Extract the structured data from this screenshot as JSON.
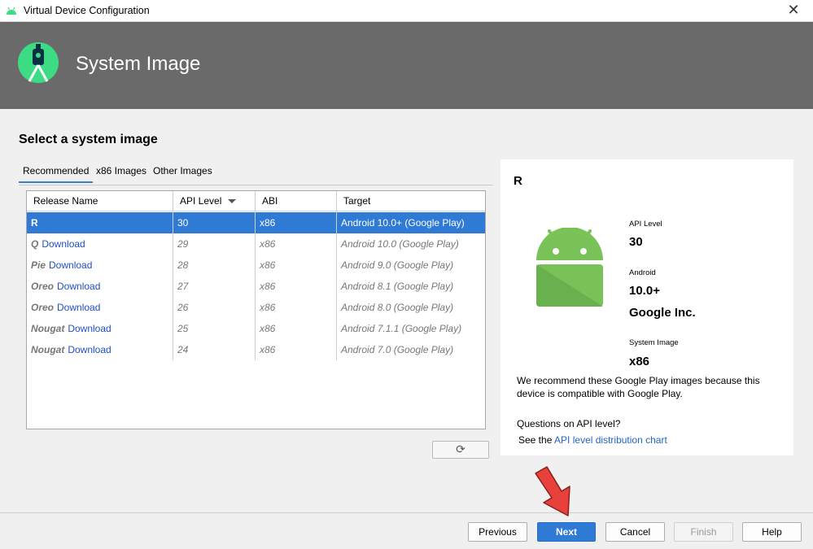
{
  "window": {
    "title": "Virtual Device Configuration",
    "close_glyph": "✕"
  },
  "header": {
    "title": "System Image"
  },
  "content": {
    "section_title": "Select a system image",
    "tabs": [
      {
        "label": "Recommended",
        "active": true
      },
      {
        "label": "x86 Images",
        "active": false
      },
      {
        "label": "Other Images",
        "active": false
      }
    ],
    "table": {
      "columns": [
        "Release Name",
        "API Level",
        "ABI",
        "Target"
      ],
      "rows": [
        {
          "release": "R",
          "download": "",
          "api": "30",
          "abi": "x86",
          "target": "Android 10.0+ (Google Play)"
        },
        {
          "release": "Q",
          "download": "Download",
          "api": "29",
          "abi": "x86",
          "target": "Android 10.0 (Google Play)"
        },
        {
          "release": "Pie",
          "download": "Download",
          "api": "28",
          "abi": "x86",
          "target": "Android 9.0 (Google Play)"
        },
        {
          "release": "Oreo",
          "download": "Download",
          "api": "27",
          "abi": "x86",
          "target": "Android 8.1 (Google Play)"
        },
        {
          "release": "Oreo",
          "download": "Download",
          "api": "26",
          "abi": "x86",
          "target": "Android 8.0 (Google Play)"
        },
        {
          "release": "Nougat",
          "download": "Download",
          "api": "25",
          "abi": "x86",
          "target": "Android 7.1.1 (Google Play)"
        },
        {
          "release": "Nougat",
          "download": "Download",
          "api": "24",
          "abi": "x86",
          "target": "Android 7.0 (Google Play)"
        }
      ]
    },
    "refresh_glyph": "⟳"
  },
  "detail": {
    "title": "R",
    "api_level_label": "API Level",
    "api_level_value": "30",
    "android_label": "Android",
    "android_value": "10.0+",
    "vendor_value": "Google Inc.",
    "system_image_label": "System Image",
    "system_image_value": "x86",
    "recommend_text": "We recommend these Google Play images because this device is compatible with Google Play.",
    "question_text": "Questions on API level?",
    "see_text": "See the",
    "link_text": "API level distribution chart"
  },
  "footer": {
    "previous": "Previous",
    "next": "Next",
    "cancel": "Cancel",
    "finish": "Finish",
    "help": "Help"
  },
  "colors": {
    "accent": "#2f7ad5",
    "android_green": "#78c257",
    "header_bg": "#6a6a6a",
    "arrow_red": "#e8403a"
  }
}
